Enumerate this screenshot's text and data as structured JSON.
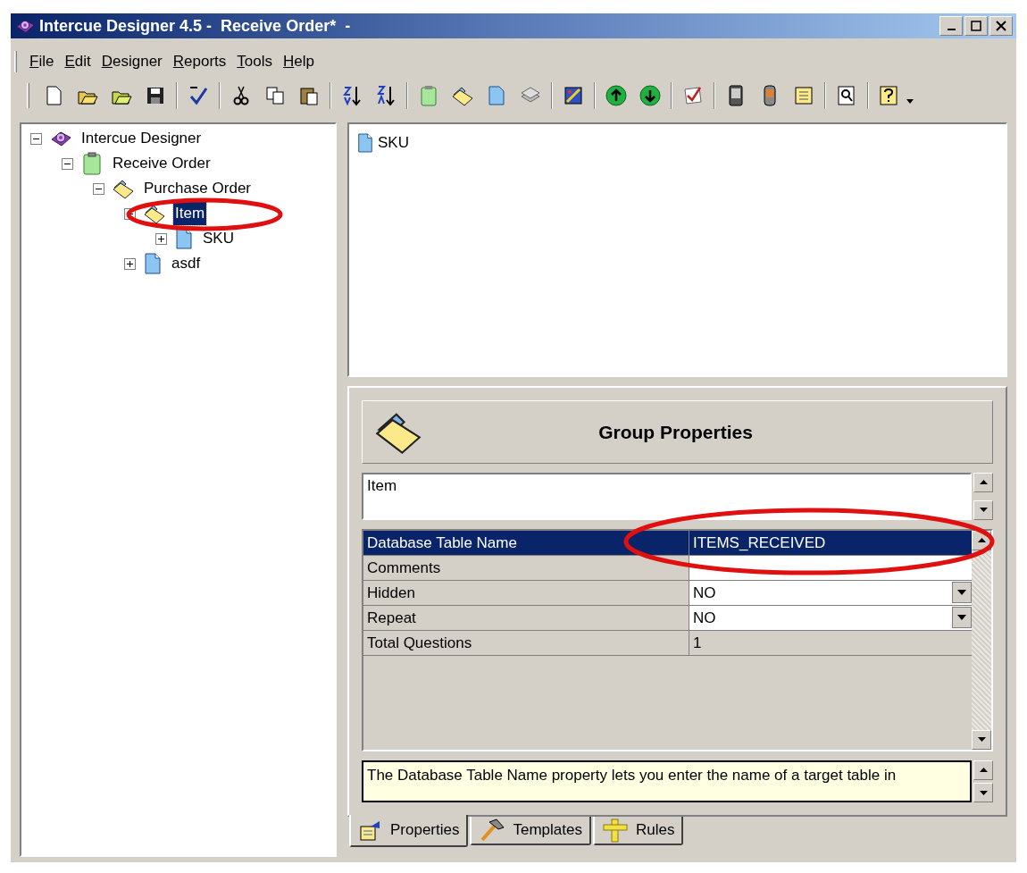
{
  "window": {
    "title": "Intercue Designer 4.5 -  Receive Order*  -"
  },
  "menu": [
    {
      "label": "File"
    },
    {
      "label": "Edit"
    },
    {
      "label": "Designer"
    },
    {
      "label": "Reports"
    },
    {
      "label": "Tools"
    },
    {
      "label": "Help"
    }
  ],
  "tree": [
    {
      "label": "Intercue Designer",
      "kind": "designer",
      "expanded": true,
      "selected": false,
      "children": [
        {
          "label": "Receive Order",
          "kind": "form",
          "expanded": true,
          "selected": false,
          "children": [
            {
              "label": "Purchase Order",
              "kind": "group",
              "expanded": true,
              "selected": false,
              "children": [
                {
                  "label": "Item",
                  "kind": "group",
                  "expanded": true,
                  "selected": true,
                  "children": [
                    {
                      "label": "SKU",
                      "kind": "question",
                      "expanded": false,
                      "selected": false
                    }
                  ]
                },
                {
                  "label": "asdf",
                  "kind": "question",
                  "expanded": false,
                  "selected": false
                }
              ]
            }
          ]
        }
      ]
    }
  ],
  "list": [
    {
      "label": "SKU",
      "kind": "question"
    }
  ],
  "properties": {
    "title": "Group Properties",
    "name": "Item",
    "rows": [
      {
        "name": "Database Table Name",
        "value": "ITEMS_RECEIVED",
        "kind": "text",
        "selected": true
      },
      {
        "name": "Comments",
        "value": "",
        "kind": "text",
        "selected": false
      },
      {
        "name": "Hidden",
        "value": "NO",
        "kind": "dropdown",
        "selected": false
      },
      {
        "name": "Repeat",
        "value": "NO",
        "kind": "dropdown",
        "selected": false
      },
      {
        "name": "Total Questions",
        "value": "1",
        "kind": "readonly",
        "selected": false
      }
    ],
    "description": "The Database Table Name property lets you enter the name of a target table in"
  },
  "tabs": [
    {
      "label": "Properties",
      "kind": "properties",
      "selected": true
    },
    {
      "label": "Templates",
      "kind": "templates",
      "selected": false
    },
    {
      "label": "Rules",
      "kind": "rules",
      "selected": false
    }
  ]
}
